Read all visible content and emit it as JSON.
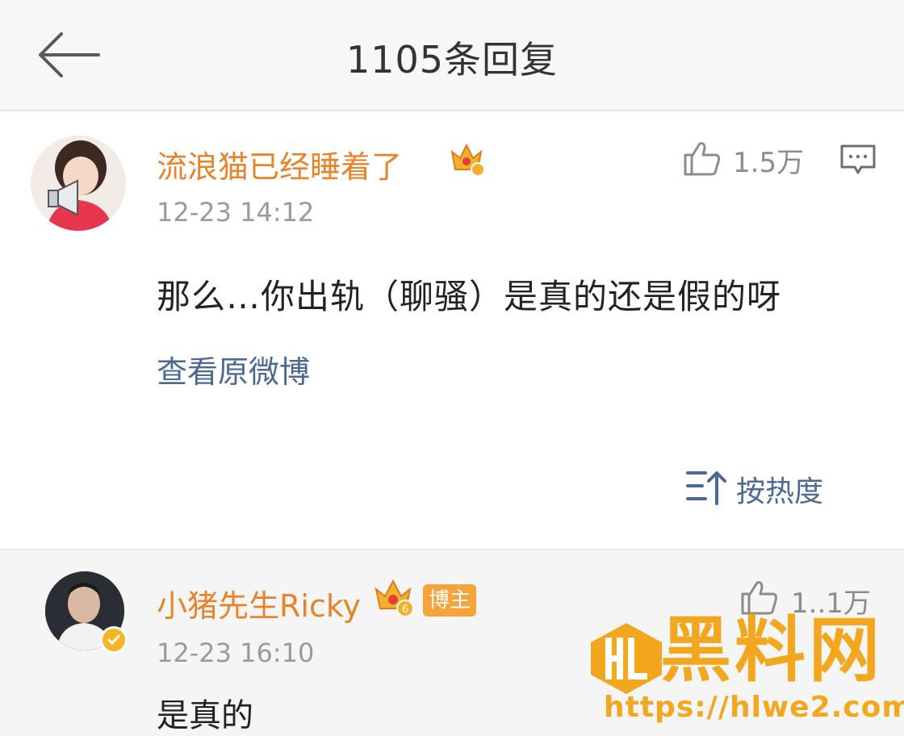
{
  "header": {
    "title": "1105条回复"
  },
  "main_comment": {
    "username": "流浪猫已经睡着了",
    "time": "12-23 14:12",
    "likes": "1.5万",
    "content": "那么…你出轨（聊骚）是真的还是假的呀",
    "view_original": "查看原微博",
    "sort_label": "按热度"
  },
  "reply": {
    "username": "小猪先生Ricky",
    "badge": "博主",
    "crown_level": "6",
    "likes": "1..1万",
    "time": "12-23 16:10",
    "content": "是真的"
  },
  "watermark": {
    "text": "黑料网",
    "url": "https://hlwe2.com"
  },
  "colors": {
    "username": "#e8832a",
    "link": "#4a6a93",
    "badge": "#f5a43c",
    "watermark": "#f3a71f",
    "reply_bg": "#f5f5f5"
  },
  "icons": [
    "back-arrow-icon",
    "crown-vip-icon",
    "thumbs-up-icon",
    "comment-icon",
    "sort-icon",
    "verified-badge-icon"
  ]
}
